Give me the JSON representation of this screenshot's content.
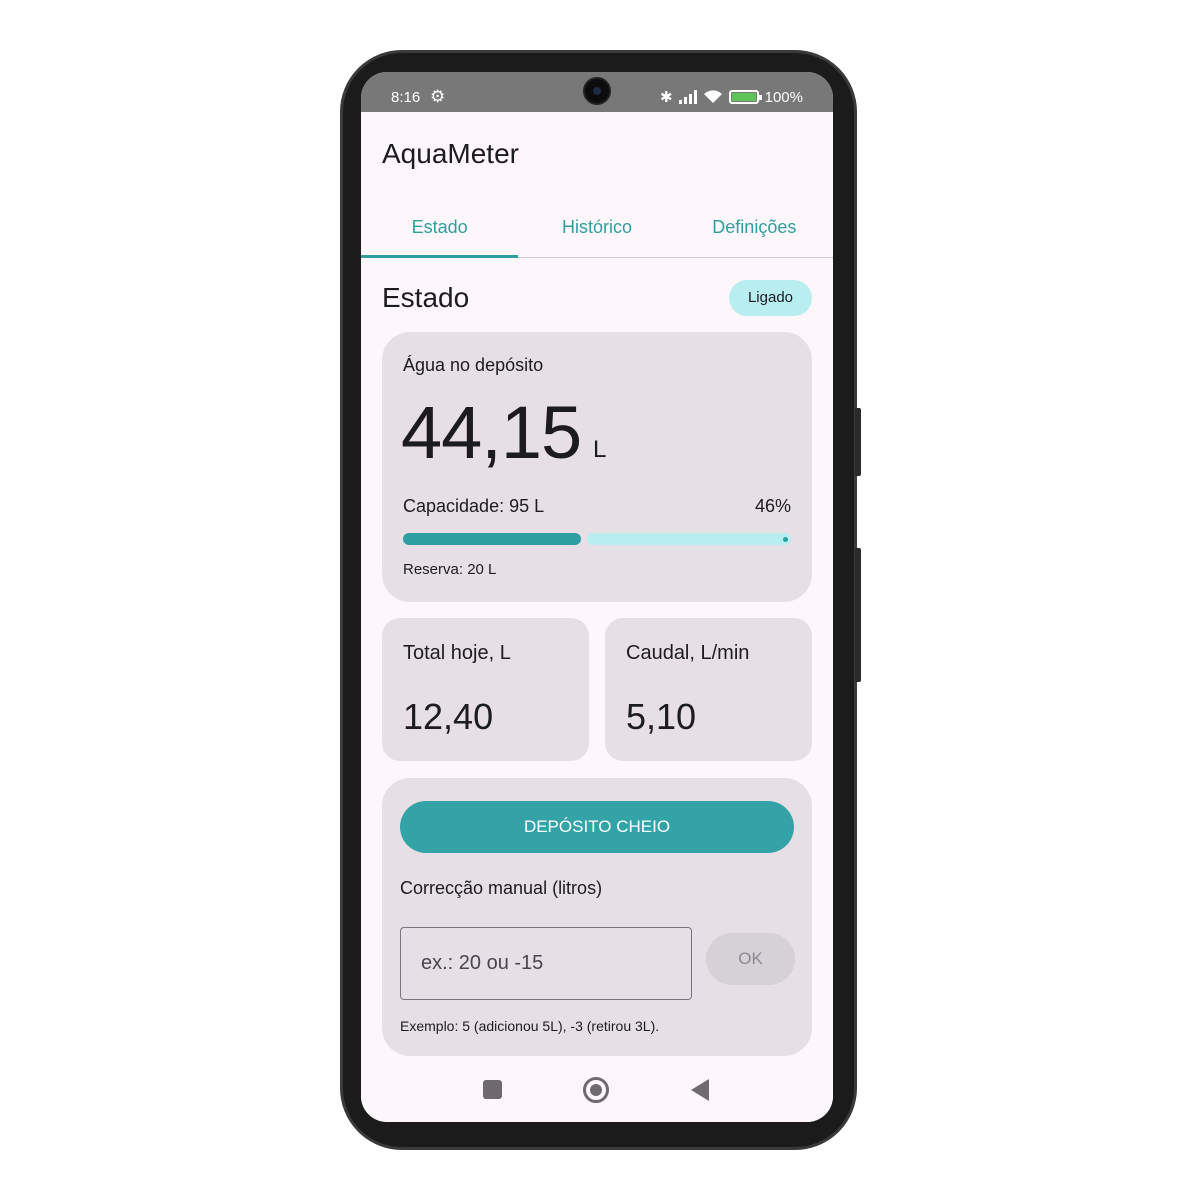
{
  "status_bar": {
    "time": "8:16",
    "battery_percent": "100%",
    "icons": [
      "settings-gear-icon",
      "bluetooth-icon",
      "signal-icon",
      "wifi-icon",
      "battery-icon"
    ]
  },
  "app": {
    "title": "AquaMeter"
  },
  "tabs": [
    {
      "label": "Estado",
      "active": true
    },
    {
      "label": "Histórico",
      "active": false
    },
    {
      "label": "Definições",
      "active": false
    }
  ],
  "section": {
    "title": "Estado",
    "status_chip": "Ligado"
  },
  "water_card": {
    "label": "Água no depósito",
    "value": "44,15",
    "unit": "L",
    "capacity_label": "Capacidade: 95 L",
    "fill_percent_label": "46%",
    "fill_fraction": 0.46,
    "reserve_label": "Reserva: 20 L"
  },
  "stats": [
    {
      "label": "Total hoje, L",
      "value": "12,40"
    },
    {
      "label": "Caudal, L/min",
      "value": "5,10"
    }
  ],
  "actions": {
    "full_button": "DEPÓSITO CHEIO",
    "manual_label": "Correcção manual (litros)",
    "manual_placeholder": "ex.: 20 ou -15",
    "ok_button": "OK",
    "example": "Exemplo: 5 (adicionou 5L), -3 (retirou 3L)."
  },
  "colors": {
    "accent": "#2e9fa0",
    "chip_bg": "#b8eef0",
    "card_bg": "#e6e0e6",
    "screen_bg": "#fdf7fc"
  }
}
